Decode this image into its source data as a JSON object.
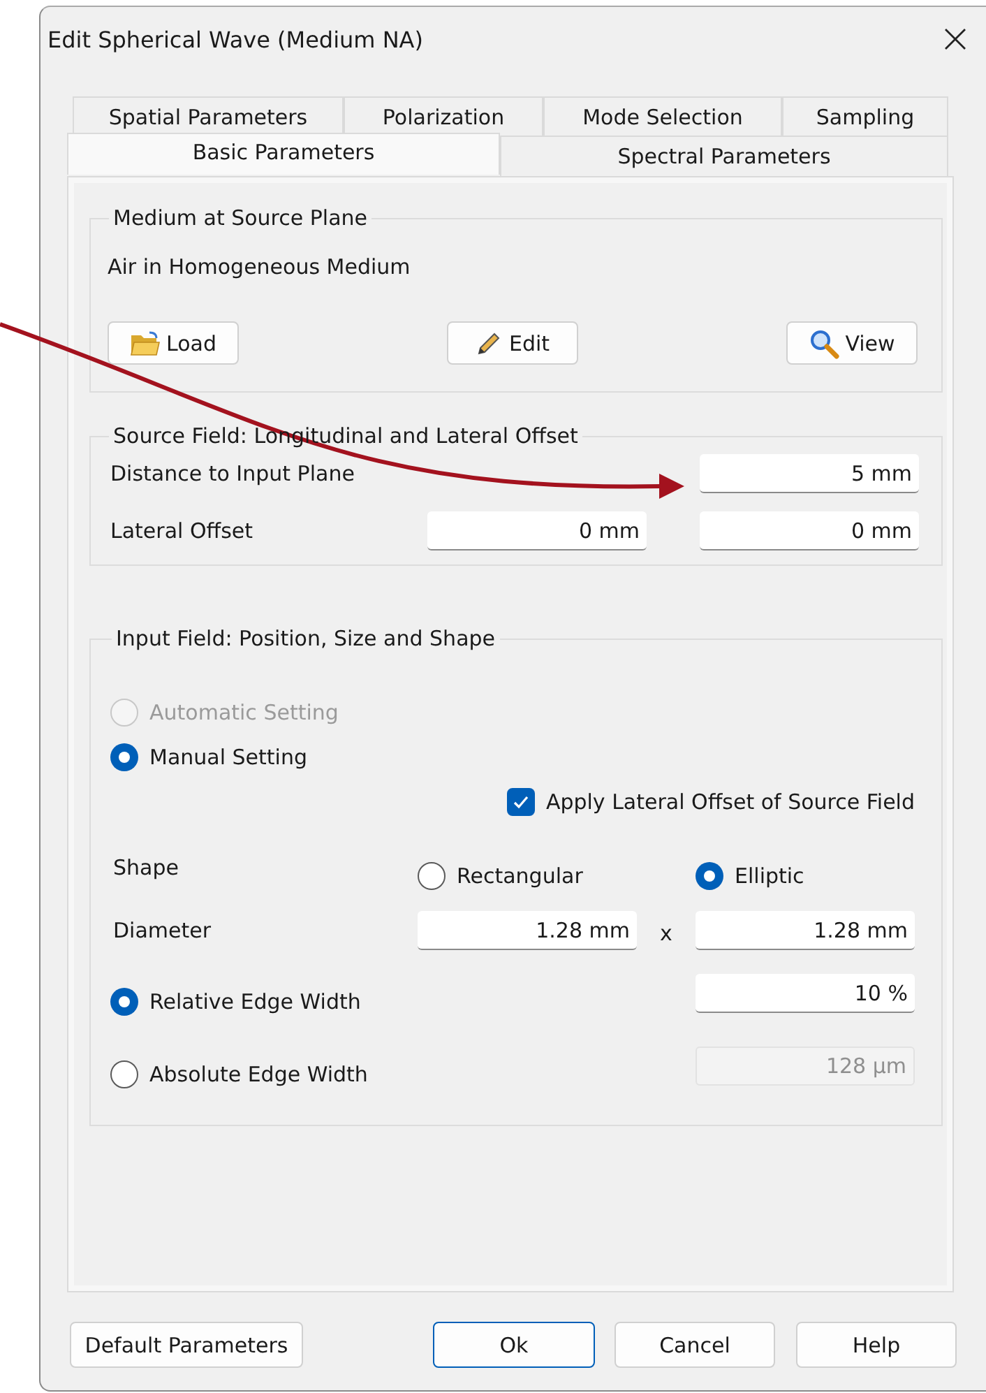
{
  "window": {
    "title": "Edit Spherical Wave (Medium NA)"
  },
  "tab_rows": [
    [
      {
        "label": "Spatial Parameters",
        "selected": false
      },
      {
        "label": "Polarization",
        "selected": false
      },
      {
        "label": "Mode Selection",
        "selected": false
      },
      {
        "label": "Sampling",
        "selected": false
      }
    ],
    [
      {
        "label": "Basic Parameters",
        "selected": true
      },
      {
        "label": "Spectral Parameters",
        "selected": false
      }
    ]
  ],
  "medium_group": {
    "title": "Medium at Source Plane",
    "medium": "Air in Homogeneous Medium",
    "buttons": [
      {
        "label": "Load",
        "kind": "folder"
      },
      {
        "label": "Edit",
        "kind": "pencil"
      },
      {
        "label": "View",
        "kind": "magnifier"
      }
    ]
  },
  "source_group": {
    "title": "Source Field: Longitudinal and Lateral Offset",
    "rows": [
      {
        "label": "Distance to Input Plane",
        "values": [
          "5 mm"
        ]
      },
      {
        "label": "Lateral Offset",
        "values": [
          "0 mm",
          "0 mm"
        ]
      }
    ]
  },
  "input_group": {
    "title": "Input Field: Position, Size and Shape",
    "setting_options": [
      {
        "label": "Automatic Setting",
        "selected": false,
        "disabled": true
      },
      {
        "label": "Manual Setting",
        "selected": true,
        "disabled": false
      }
    ],
    "apply_offset": {
      "label": "Apply Lateral Offset of Source Field",
      "checked": true
    },
    "shape": {
      "label": "Shape",
      "options": [
        {
          "label": "Rectangular",
          "selected": false
        },
        {
          "label": "Elliptic",
          "selected": true
        }
      ]
    },
    "diameter": {
      "label": "Diameter",
      "separator": "x",
      "values": [
        "1.28 mm",
        "1.28 mm"
      ]
    },
    "edge_options": [
      {
        "label": "Relative Edge Width",
        "selected": true,
        "value": "10 %",
        "field_disabled": false
      },
      {
        "label": "Absolute Edge Width",
        "selected": false,
        "value": "128 µm",
        "field_disabled": true
      }
    ]
  },
  "footer_buttons": [
    {
      "label": "Default Parameters",
      "default": false
    },
    {
      "label": "Ok",
      "default": true
    },
    {
      "label": "Cancel",
      "default": false
    },
    {
      "label": "Help",
      "default": false
    }
  ]
}
